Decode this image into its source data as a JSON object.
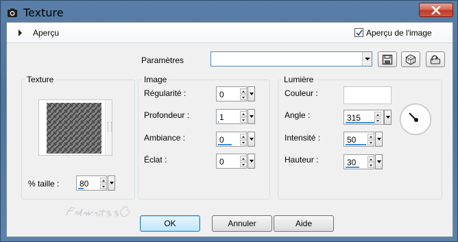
{
  "window": {
    "title": "Texture",
    "icon": "camera-app-icon",
    "close_icon": "close-icon",
    "accent": "#4f7399",
    "close_color": "#c0392b"
  },
  "topbar": {
    "expander_icon": "triangle-right-icon",
    "apercu_label": "Aperçu",
    "preview_checkbox_label": "Aperçu de l'image",
    "preview_checked": true
  },
  "parametres": {
    "label": "Paramètres",
    "value": "",
    "buttons": [
      "save-preset-icon",
      "randomize-dice-icon",
      "reset-defaults-icon"
    ]
  },
  "texture_group": {
    "title": "Texture",
    "size_label": "% taille :",
    "size_value": "80"
  },
  "image_group": {
    "title": "Image",
    "fields": [
      {
        "label": "Régularité :",
        "value": "0",
        "level": 0
      },
      {
        "label": "Profondeur :",
        "value": "1",
        "level": 0.02
      },
      {
        "label": "Ambiance :",
        "value": "0",
        "level": 0.5
      },
      {
        "label": "Éclat :",
        "value": "0",
        "level": 0
      }
    ]
  },
  "lumiere_group": {
    "title": "Lumière",
    "color_label": "Couleur :",
    "color_value": "#ffffff",
    "angle_label": "Angle :",
    "angle_value": "315",
    "intensity_label": "Intensité :",
    "intensity_value": "50",
    "height_label": "Hauteur :",
    "height_value": "30",
    "dial_icon": "angle-dial-icon"
  },
  "footer": {
    "ok": "OK",
    "cancel": "Annuler",
    "help": "Aide"
  }
}
